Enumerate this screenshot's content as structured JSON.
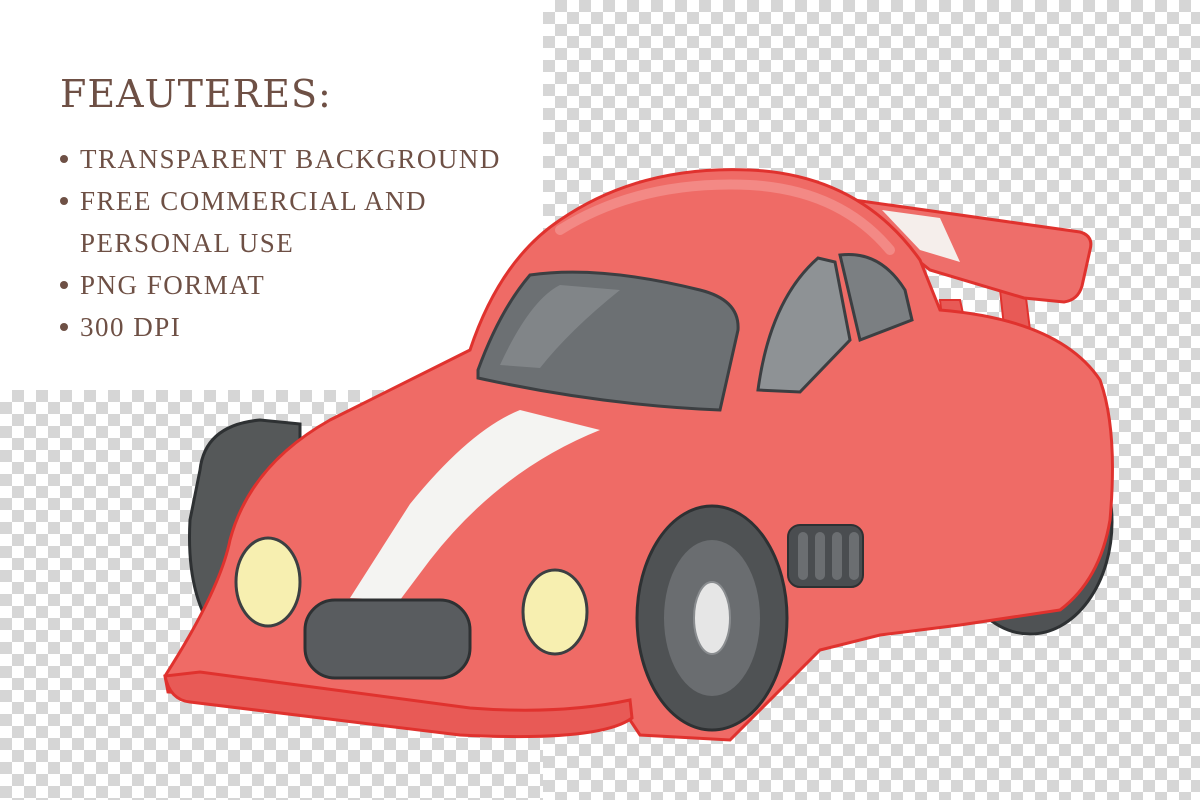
{
  "title": "FEAUTERES:",
  "features": [
    {
      "line1": "TRANSPARENT BACKGROUND",
      "line2": ""
    },
    {
      "line1": "FREE COMMERCIAL AND",
      "line2": "PERSONAL USE"
    },
    {
      "line1": "PNG FORMAT",
      "line2": ""
    },
    {
      "line1": "300 DPI",
      "line2": ""
    }
  ],
  "illustration": "red-race-car",
  "colors": {
    "text": "#6e5045",
    "car_body": "#ef6b66",
    "car_outline": "#e0322e",
    "stripe": "#f4f4f2",
    "tire": "#555555",
    "window": "#6c7073",
    "headlight": "#f7efb0"
  }
}
